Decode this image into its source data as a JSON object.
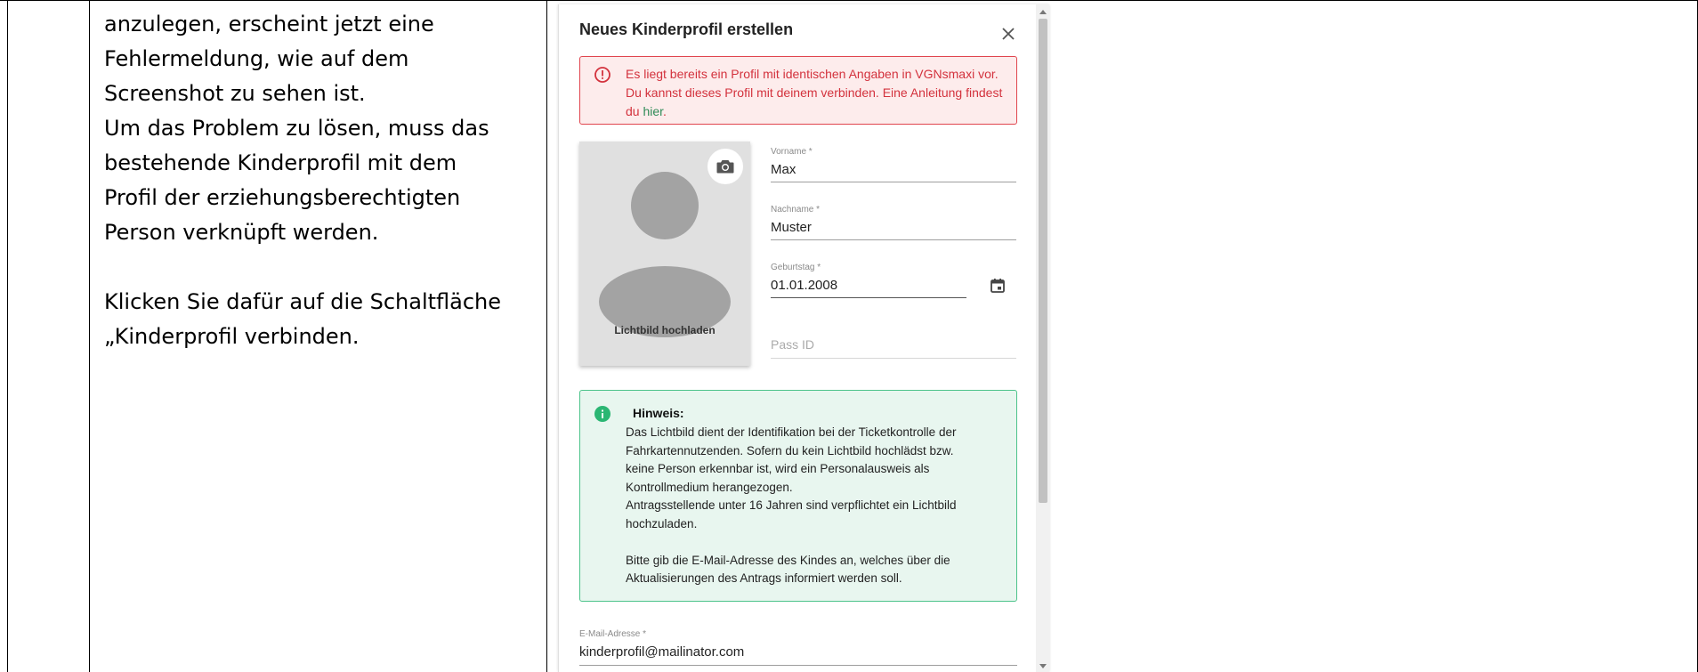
{
  "document": {
    "lines": [
      "anzulegen, erscheint jetzt eine",
      "Fehlermeldung, wie auf dem",
      "Screenshot zu sehen ist.",
      "Um das Problem zu lösen, muss das",
      "bestehende Kinderprofil mit dem",
      "Profil der erziehungsberechtigten",
      "Person verknüpft werden."
    ],
    "lines2": [
      "Klicken Sie dafür auf die Schaltfläche",
      "„Kinderprofil verbinden."
    ]
  },
  "dialog": {
    "title": "Neues Kinderprofil erstellen",
    "error": {
      "text": "Es liegt bereits ein Profil mit identischen Angaben in VGNsmaxi vor. Du kannst dieses Profil mit deinem verbinden. Eine Anleitung findest du ",
      "link": "hier",
      "end": "."
    },
    "photo": {
      "label": "Lichtbild hochladen"
    },
    "fields": {
      "vorname": {
        "label": "Vorname *",
        "value": "Max"
      },
      "nachname": {
        "label": "Nachname *",
        "value": "Muster"
      },
      "geburtstag": {
        "label": "Geburtstag *",
        "value": "01.01.2008"
      },
      "passid": {
        "placeholder": "Pass ID"
      },
      "email": {
        "label": "E-Mail-Adresse *",
        "value": "kinderprofil@mailinator.com"
      }
    },
    "hint": {
      "title": "Hinweis:",
      "lines": [
        "Das Lichtbild dient der Identifikation bei der Ticketkontrolle der",
        "Fahrkartennutzenden. Sofern du kein Lichtbild hochlädst bzw.",
        "keine Person erkennbar ist, wird ein Personalausweis als",
        "Kontrollmedium herangezogen.",
        "Antragsstellende unter 16 Jahren sind verpflichtet ein Lichtbild",
        "hochzuladen."
      ],
      "lines2": [
        "Bitte gib die E-Mail-Adresse des Kindes an, welches über die",
        "Aktualisierungen des Antrags informiert werden soll."
      ]
    },
    "colors": {
      "error": "#d3323d",
      "success": "#4cc38a",
      "link": "#2e8b57"
    },
    "icons": [
      "close-icon",
      "error-icon",
      "camera-icon",
      "calendar-icon",
      "info-icon"
    ]
  }
}
